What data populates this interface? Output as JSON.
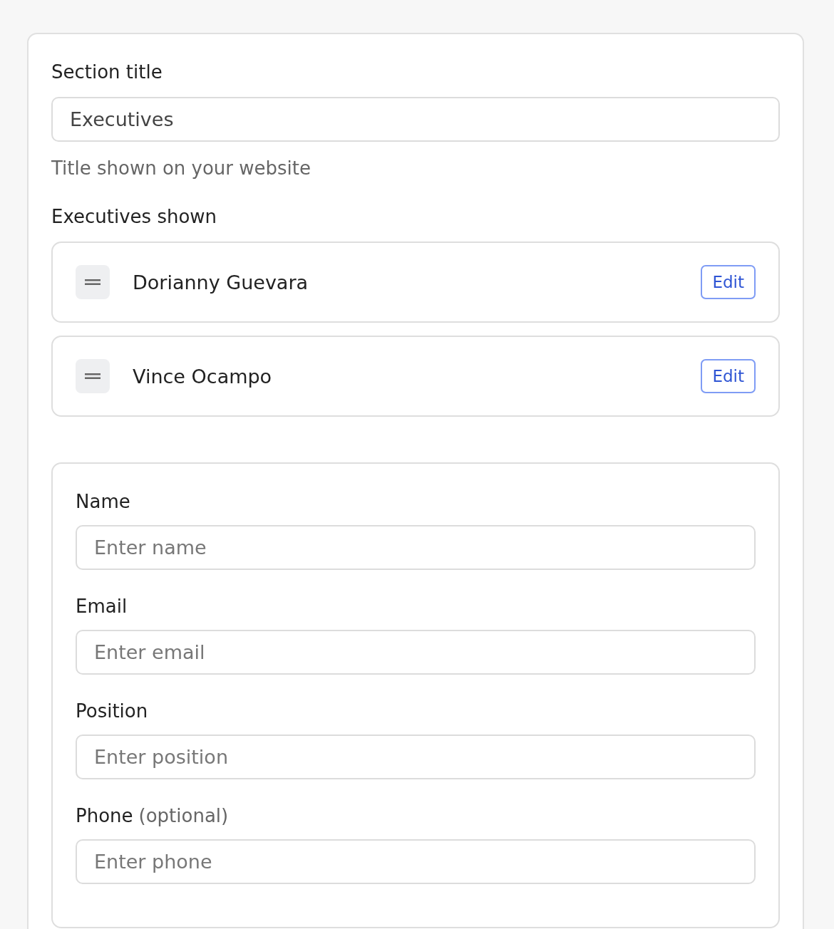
{
  "section_title": {
    "label": "Section title",
    "value": "Executives",
    "helper": "Title shown on your website"
  },
  "executives": {
    "label": "Executives shown",
    "items": [
      {
        "name": "Dorianny Guevara",
        "action": "Edit"
      },
      {
        "name": "Vince Ocampo",
        "action": "Edit"
      }
    ]
  },
  "form": {
    "fields": [
      {
        "label": "Name",
        "placeholder": "Enter name"
      },
      {
        "label": "Email",
        "placeholder": "Enter email"
      },
      {
        "label": "Position",
        "placeholder": "Enter position"
      },
      {
        "label": "Phone",
        "hint": "(optional)",
        "placeholder": "Enter phone"
      }
    ]
  }
}
